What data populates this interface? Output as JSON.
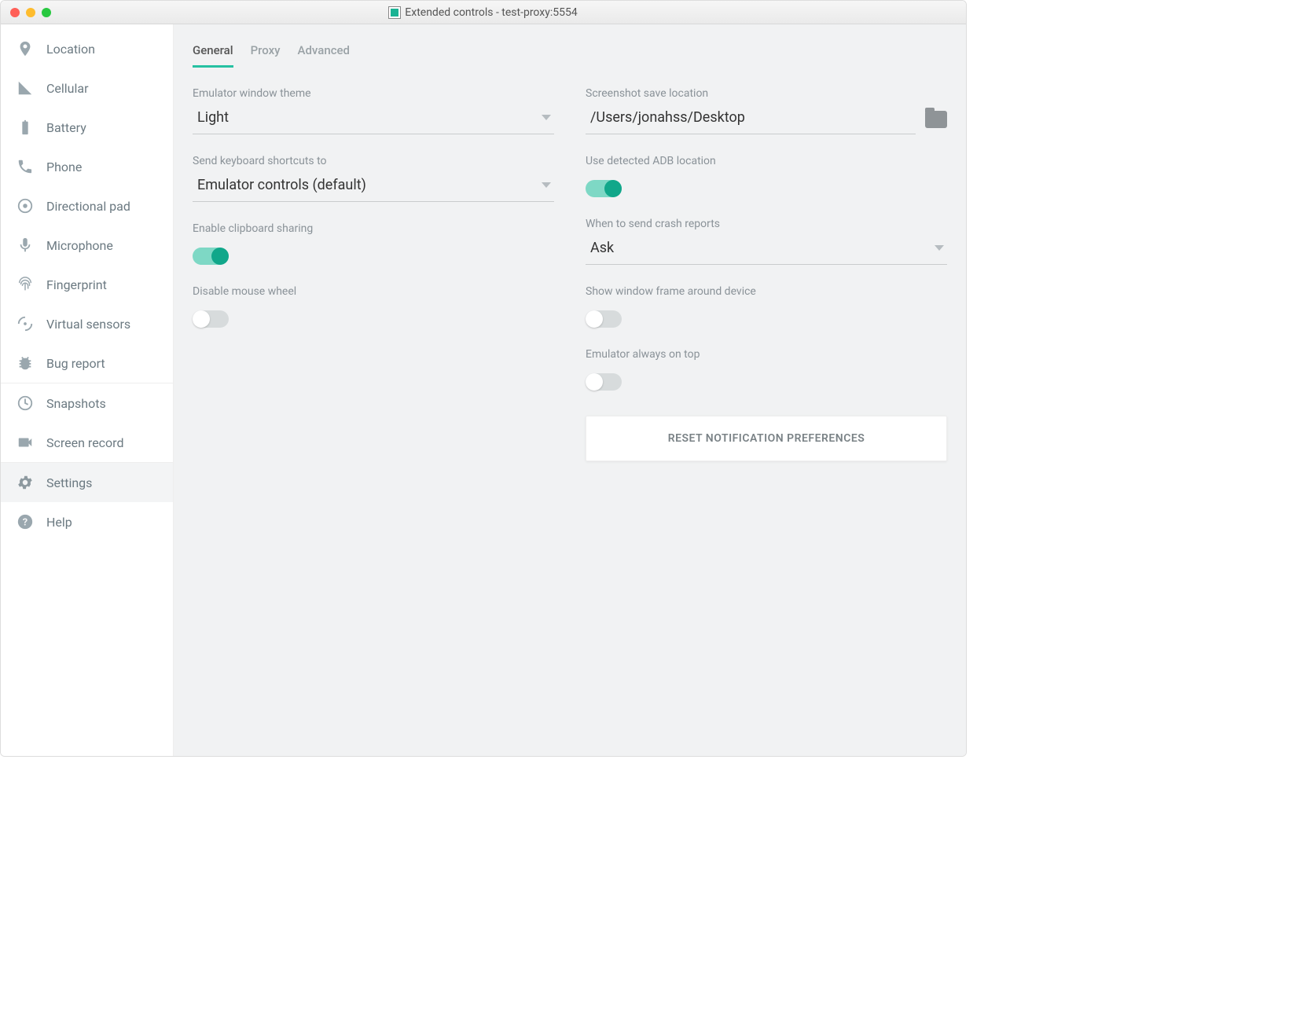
{
  "window": {
    "title": "Extended controls - test-proxy:5554"
  },
  "sidebar": {
    "items": [
      {
        "label": "Location"
      },
      {
        "label": "Cellular"
      },
      {
        "label": "Battery"
      },
      {
        "label": "Phone"
      },
      {
        "label": "Directional pad"
      },
      {
        "label": "Microphone"
      },
      {
        "label": "Fingerprint"
      },
      {
        "label": "Virtual sensors"
      },
      {
        "label": "Bug report"
      },
      {
        "label": "Snapshots"
      },
      {
        "label": "Screen record"
      },
      {
        "label": "Settings"
      },
      {
        "label": "Help"
      }
    ]
  },
  "tabs": {
    "items": [
      {
        "label": "General"
      },
      {
        "label": "Proxy"
      },
      {
        "label": "Advanced"
      }
    ]
  },
  "settings": {
    "theme_label": "Emulator window theme",
    "theme_value": "Light",
    "shortcuts_label": "Send keyboard shortcuts to",
    "shortcuts_value": "Emulator controls (default)",
    "clipboard_label": "Enable clipboard sharing",
    "mousewheel_label": "Disable mouse wheel",
    "screenshot_label": "Screenshot save location",
    "screenshot_value": "/Users/jonahss/Desktop",
    "adb_label": "Use detected ADB location",
    "crash_label": "When to send crash reports",
    "crash_value": "Ask",
    "windowframe_label": "Show window frame around device",
    "ontop_label": "Emulator always on top",
    "reset_label": "RESET NOTIFICATION PREFERENCES"
  }
}
